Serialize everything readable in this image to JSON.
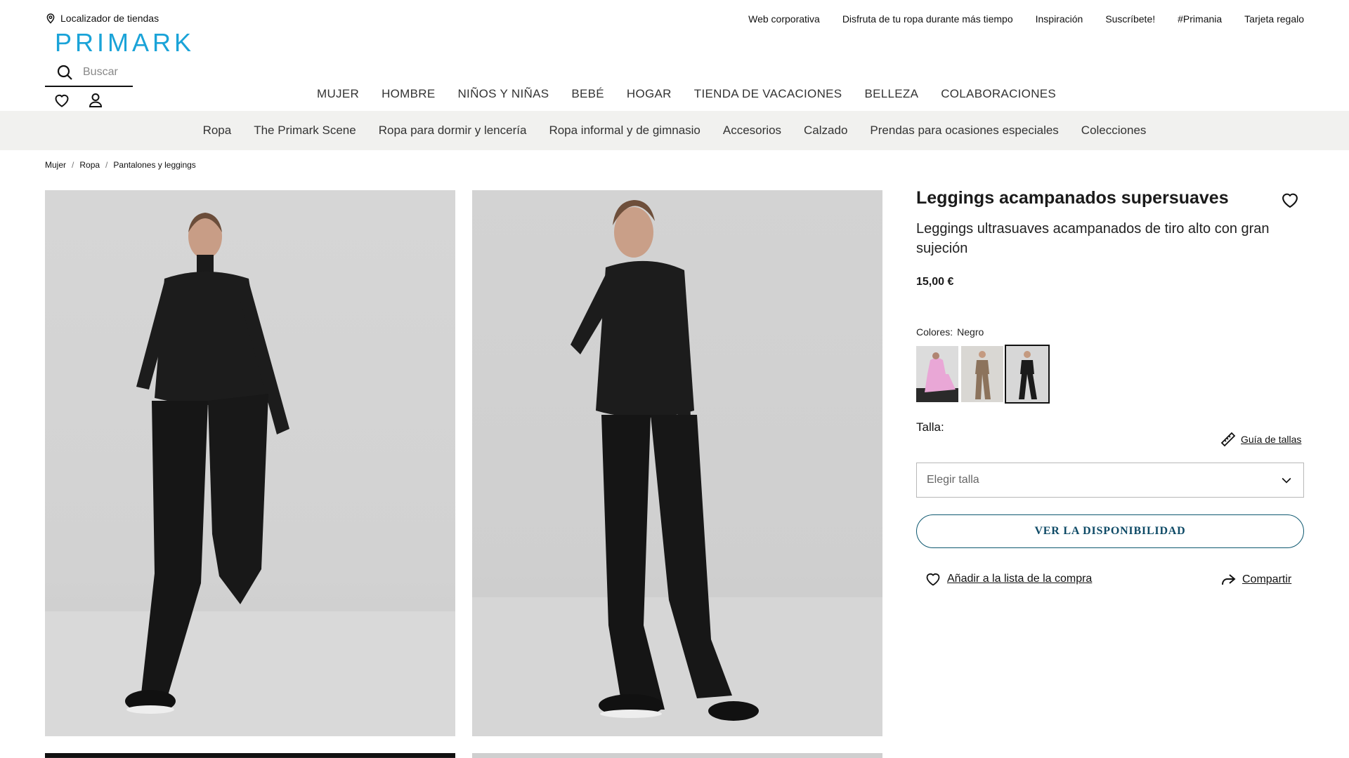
{
  "store_locator": {
    "label": "Localizador de tiendas",
    "icon": "location-pin-icon"
  },
  "top_links": [
    "Web corporativa",
    "Disfruta de tu ropa durante más tiempo",
    "Inspiración",
    "Suscríbete!",
    "#Primania",
    "Tarjeta regalo"
  ],
  "logo": {
    "text": "PRIMARK",
    "color": "#1aa3d8"
  },
  "search": {
    "placeholder": "Buscar",
    "icon": "search-icon"
  },
  "account": {
    "wishlist_icon": "heart-icon",
    "user_icon": "user-icon"
  },
  "main_nav": [
    "MUJER",
    "HOMBRE",
    "NIÑOS Y NIÑAS",
    "BEBÉ",
    "HOGAR",
    "TIENDA DE VACACIONES",
    "BELLEZA",
    "COLABORACIONES"
  ],
  "sub_nav": [
    "Ropa",
    "The Primark Scene",
    "Ropa para dormir y lencería",
    "Ropa informal y de gimnasio",
    "Accesorios",
    "Calzado",
    "Prendas para ocasiones especiales",
    "Colecciones"
  ],
  "breadcrumb": [
    "Mujer",
    "Ropa",
    "Pantalones y leggings"
  ],
  "breadcrumb_separator": "/",
  "product": {
    "title": "Leggings acampanados supersuaves",
    "description": "Leggings ultrasuaves acampanados de tiro alto con gran sujeción",
    "price": "15,00 €",
    "colors_label": "Colores:",
    "selected_color": "Negro",
    "swatches": [
      {
        "color": "#e9a7d6",
        "selected": false
      },
      {
        "color": "#8c735c",
        "selected": false
      },
      {
        "color": "#1b1b1b",
        "selected": true
      }
    ],
    "size_label": "Talla:",
    "size_guide": "Guía de tallas",
    "size_placeholder": "Elegir talla",
    "availability_button": "VER LA DISPONIBILIDAD",
    "shopping_list": "Añadir a la lista de la compra",
    "share": "Compartir"
  },
  "colors": {
    "accent": "#0e4a66",
    "brand": "#1aa3d8",
    "subnav_bg": "#f1f1ef"
  }
}
